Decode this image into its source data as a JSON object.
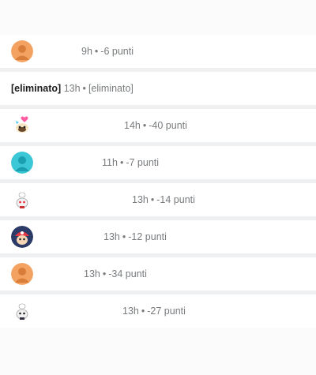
{
  "comments": [
    {
      "avatar": "orange-default-avatar-icon",
      "time": "9h",
      "score": "-6 punti"
    },
    {
      "user": "[eliminato]",
      "time": "13h",
      "body": "[eliminato]"
    },
    {
      "avatar": "snoo-heart-avatar-icon",
      "time": "14h",
      "score": "-40 punti"
    },
    {
      "avatar": "teal-default-avatar-icon",
      "time": "11h",
      "score": "-7 punti"
    },
    {
      "avatar": "snoo-chef-avatar-icon",
      "time": "13h",
      "score": "-14 punti"
    },
    {
      "avatar": "snoo-cap-avatar-icon",
      "time": "13h",
      "score": "-12 punti"
    },
    {
      "avatar": "orange-default-avatar-icon",
      "time": "13h",
      "score": "-34 punti"
    },
    {
      "avatar": "snoo-chef-avatar-icon",
      "time": "13h",
      "score": "-27 punti"
    }
  ],
  "separator": "•",
  "colors": {
    "meta": "#787c7e",
    "separator_bar": "#eef0f2",
    "orange_avatar": "#f4a261",
    "teal_avatar": "#3cc7d6"
  }
}
